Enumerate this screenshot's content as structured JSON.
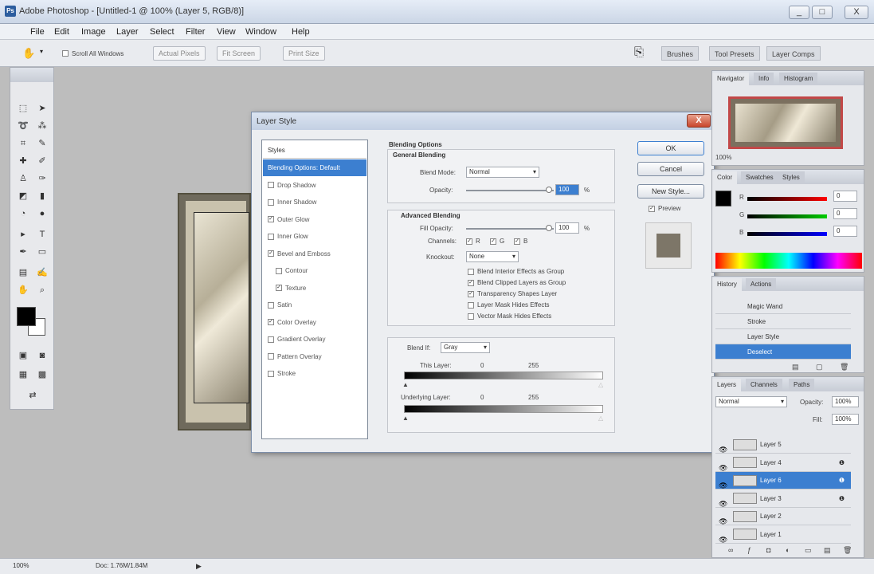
{
  "window": {
    "title": "Adobe Photoshop - [Untitled-1 @ 100% (Layer 5, RGB/8)]",
    "min": "_",
    "max": "□",
    "close": "X"
  },
  "menu": [
    "File",
    "Edit",
    "Image",
    "Layer",
    "Select",
    "Filter",
    "View",
    "Window",
    "Help"
  ],
  "options": {
    "scroll_all": "Scroll All Windows",
    "actual_pixels": "Actual Pixels",
    "fit_screen": "Fit Screen",
    "print_size": "Print Size"
  },
  "workspace_tabs": [
    "Brushes",
    "Tool Presets",
    "Layer Comps"
  ],
  "dialog": {
    "title": "Layer Style",
    "close": "X",
    "styles_header": "Styles",
    "styles": [
      {
        "label": "Blending Options: Default",
        "checked": false,
        "active": true
      },
      {
        "label": "Drop Shadow",
        "checked": false
      },
      {
        "label": "Inner Shadow",
        "checked": false
      },
      {
        "label": "Outer Glow",
        "checked": true
      },
      {
        "label": "Inner Glow",
        "checked": false
      },
      {
        "label": "Bevel and Emboss",
        "checked": true
      },
      {
        "label": "Contour",
        "checked": false
      },
      {
        "label": "Texture",
        "checked": true
      },
      {
        "label": "Satin",
        "checked": false
      },
      {
        "label": "Color Overlay",
        "checked": true
      },
      {
        "label": "Gradient Overlay",
        "checked": false
      },
      {
        "label": "Pattern Overlay",
        "checked": false
      },
      {
        "label": "Stroke",
        "checked": false
      }
    ],
    "blending_options": "Blending Options",
    "general_blending": "General Blending",
    "blend_mode_label": "Blend Mode:",
    "blend_mode": "Normal",
    "opacity_label": "Opacity:",
    "opacity": "100",
    "advanced_blending": "Advanced Blending",
    "fill_opacity_label": "Fill Opacity:",
    "fill_opacity": "100",
    "percent": "%",
    "channels_label": "Channels:",
    "channels": [
      "R",
      "G",
      "B"
    ],
    "knockout_label": "Knockout:",
    "knockout": "None",
    "advanced_checks": [
      {
        "label": "Blend Interior Effects as Group",
        "checked": false
      },
      {
        "label": "Blend Clipped Layers as Group",
        "checked": true
      },
      {
        "label": "Transparency Shapes Layer",
        "checked": true
      },
      {
        "label": "Layer Mask Hides Effects",
        "checked": false
      },
      {
        "label": "Vector Mask Hides Effects",
        "checked": false
      }
    ],
    "blend_if_label": "Blend If:",
    "blend_if": "Gray",
    "this_layer_label": "This Layer:",
    "this_layer_low": "0",
    "this_layer_high": "255",
    "underlying_label": "Underlying Layer:",
    "underlying_low": "0",
    "underlying_high": "255",
    "ok": "OK",
    "cancel": "Cancel",
    "new_style": "New Style...",
    "preview_label": "Preview"
  },
  "navigator": {
    "tabs": [
      "Navigator",
      "Info",
      "Histogram"
    ],
    "zoom": "100%"
  },
  "color": {
    "tabs": [
      "Color",
      "Swatches",
      "Styles"
    ],
    "channels": [
      "R",
      "G",
      "B"
    ],
    "values": [
      "0",
      "0",
      "0"
    ]
  },
  "history": {
    "tabs": [
      "History",
      "Actions"
    ],
    "items": [
      "Magic Wand",
      "Stroke",
      "Layer Style",
      "Deselect"
    ],
    "selected": 3
  },
  "layers": {
    "tabs": [
      "Layers",
      "Channels",
      "Paths"
    ],
    "blend": "Normal",
    "opacity_label": "Opacity:",
    "opacity": "100%",
    "fill_label": "Fill:",
    "fill": "100%",
    "items": [
      {
        "name": "Layer 5",
        "fx": false
      },
      {
        "name": "Layer 4",
        "fx": true
      },
      {
        "name": "Layer 6",
        "fx": true,
        "selected": true
      },
      {
        "name": "Layer 3",
        "fx": true
      },
      {
        "name": "Layer 2",
        "fx": false
      },
      {
        "name": "Layer 1",
        "fx": false
      }
    ]
  },
  "status": {
    "zoom": "100%",
    "doc": "Doc: 1.76M/1.84M"
  }
}
